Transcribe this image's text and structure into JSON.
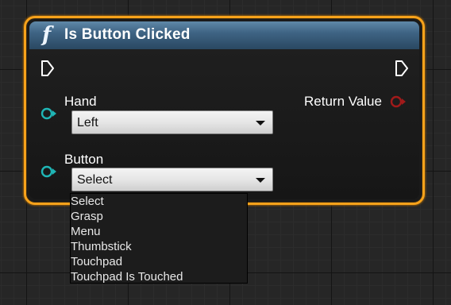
{
  "node": {
    "icon": "function-icon",
    "icon_glyph": "f",
    "title": "Is Button Clicked",
    "border_color": "#f7a21b",
    "header_color": "#3f6484",
    "exec_in_icon": "exec-pin-icon",
    "exec_out_icon": "exec-pin-icon",
    "inputs": [
      {
        "label": "Hand",
        "pin_icon": "struct-pin-icon",
        "pin_color": "#1fb5b5",
        "selected": "Left"
      },
      {
        "label": "Button",
        "pin_icon": "struct-pin-icon",
        "pin_color": "#1fb5b5",
        "selected": "Select"
      }
    ],
    "outputs": [
      {
        "label": "Return Value",
        "pin_icon": "bool-pin-icon",
        "pin_color": "#a11a1a"
      }
    ]
  },
  "dropdown": {
    "open": true,
    "options": [
      "Select",
      "Grasp",
      "Menu",
      "Thumbstick",
      "Touchpad",
      "Touchpad Is Touched"
    ]
  }
}
